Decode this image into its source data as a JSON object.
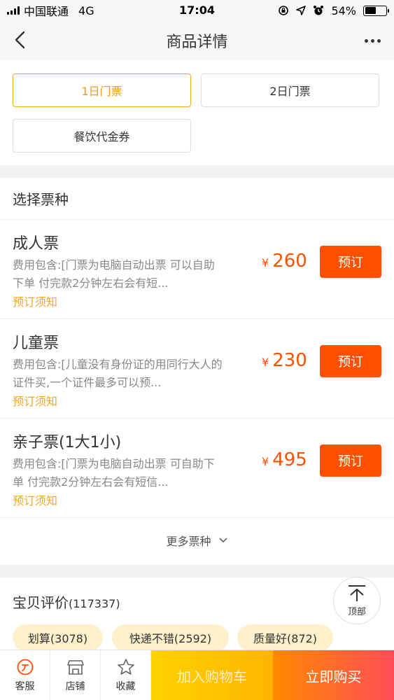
{
  "status_bar": {
    "carrier": "中国联通",
    "network": "4G",
    "time": "17:04",
    "battery": "54%",
    "battery_level": 0.54
  },
  "nav": {
    "title": "商品详情"
  },
  "options": [
    {
      "label": "1日门票",
      "selected": true
    },
    {
      "label": "2日门票",
      "selected": false
    },
    {
      "label": "餐饮代金券",
      "selected": false
    }
  ],
  "tickets": {
    "title": "选择票种",
    "items": [
      {
        "name": "成人票",
        "desc": "费用包含:[门票为电脑自动出票 可以自助下单 付完款2分钟左右会有短...",
        "notice": "预订须知",
        "currency": "¥",
        "price": "260",
        "button": "预订"
      },
      {
        "name": "儿童票",
        "desc": "费用包含:[儿童没有身份证的用同行大人的证件买,一个证件最多可以预...",
        "notice": "预订须知",
        "currency": "¥",
        "price": "230",
        "button": "预订"
      },
      {
        "name": "亲子票(1大1小)",
        "desc": "费用包含:[门票为电脑自动出票 可自助下单 付完款2分钟左右会有短信...",
        "notice": "预订须知",
        "currency": "¥",
        "price": "495",
        "button": "预订"
      }
    ],
    "more_label": "更多票种"
  },
  "reviews": {
    "title": "宝贝评价",
    "count": "(117337)",
    "tags": [
      "划算(3078)",
      "快递不错(2592)",
      "质量好(872)"
    ]
  },
  "to_top": {
    "label": "顶部"
  },
  "bottom_bar": {
    "service": "客服",
    "shop": "店铺",
    "favorite": "收藏",
    "add_to_cart": "加入购物车",
    "buy_now": "立即购买"
  },
  "colors": {
    "accent_orange": "#ff5000",
    "selected_border": "#f5a623",
    "tag_bg": "#fff0cc"
  }
}
